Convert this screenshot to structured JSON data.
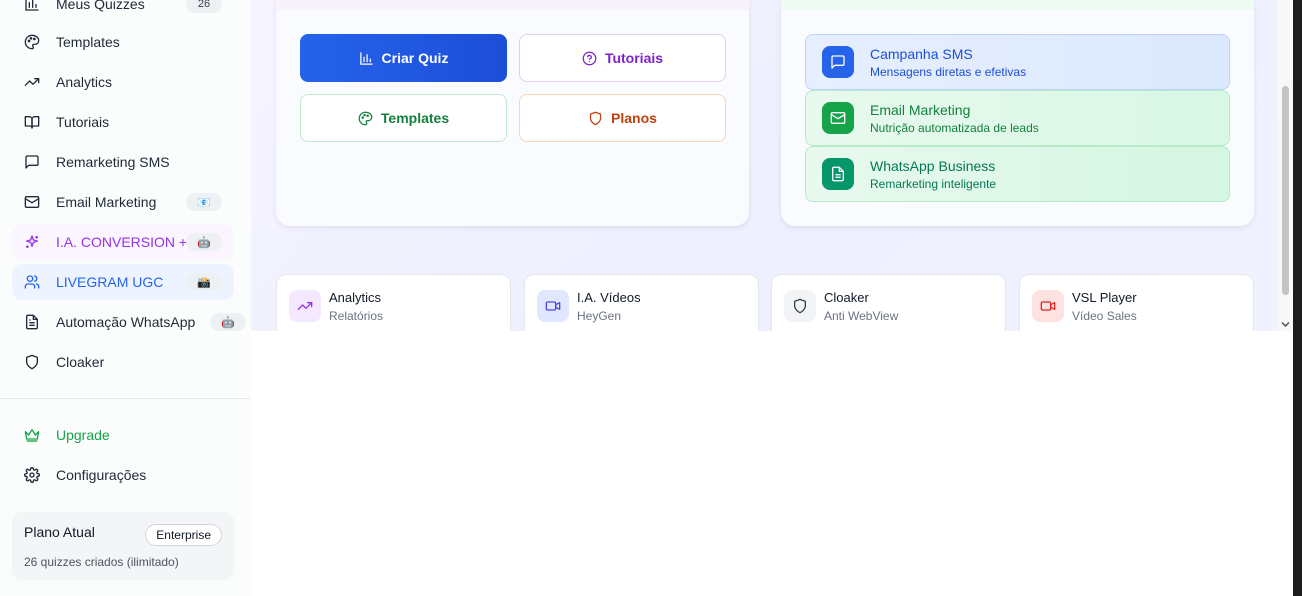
{
  "sidebar": {
    "items": [
      {
        "label": "Meus Quizzes",
        "badge": "26",
        "icon": "bar-chart-icon"
      },
      {
        "label": "Templates",
        "icon": "palette-icon"
      },
      {
        "label": "Analytics",
        "icon": "trending-up-icon"
      },
      {
        "label": "Tutoriais",
        "icon": "book-open-icon"
      },
      {
        "label": "Remarketing SMS",
        "icon": "message-square-icon"
      },
      {
        "label": "Email Marketing",
        "badge": "📧",
        "icon": "mail-icon"
      },
      {
        "label": "I.A. CONVERSION +",
        "badge": "🤖",
        "icon": "sparkles-icon"
      },
      {
        "label": "LIVEGRAM UGC",
        "badge": "📸",
        "icon": "users-icon"
      },
      {
        "label": "Automação WhatsApp",
        "badge": "🤖",
        "icon": "file-text-icon"
      },
      {
        "label": "Cloaker",
        "icon": "shield-icon"
      }
    ],
    "upgrade": {
      "label": "Upgrade",
      "icon": "crown-icon"
    },
    "settings": {
      "label": "Configurações",
      "icon": "gear-icon"
    },
    "plan": {
      "title": "Plano Atual",
      "badge": "Enterprise",
      "subtitle": "26 quizzes criados (ilimitado)"
    }
  },
  "actions": {
    "create_quiz": "Criar Quiz",
    "tutorials": "Tutoriais",
    "templates": "Templates",
    "plans": "Planos"
  },
  "features": [
    {
      "title": "Campanha SMS",
      "subtitle": "Mensagens diretas e efetivas",
      "icon": "message-square-icon"
    },
    {
      "title": "Email Marketing",
      "subtitle": "Nutrição automatizada de leads",
      "icon": "mail-icon"
    },
    {
      "title": "WhatsApp Business",
      "subtitle": "Remarketing inteligente",
      "icon": "file-text-icon"
    }
  ],
  "tools": [
    {
      "title": "Analytics",
      "subtitle": "Relatórios",
      "icon": "trending-up-icon"
    },
    {
      "title": "I.A. Vídeos",
      "subtitle": "HeyGen",
      "icon": "video-icon"
    },
    {
      "title": "Cloaker",
      "subtitle": "Anti WebView",
      "icon": "shield-icon"
    },
    {
      "title": "VSL Player",
      "subtitle": "Vídeo Sales",
      "icon": "video-icon"
    }
  ],
  "colors": {
    "primary": "#2563eb",
    "purple": "#9333ea",
    "green": "#16a34a",
    "orange": "#c2410c"
  }
}
